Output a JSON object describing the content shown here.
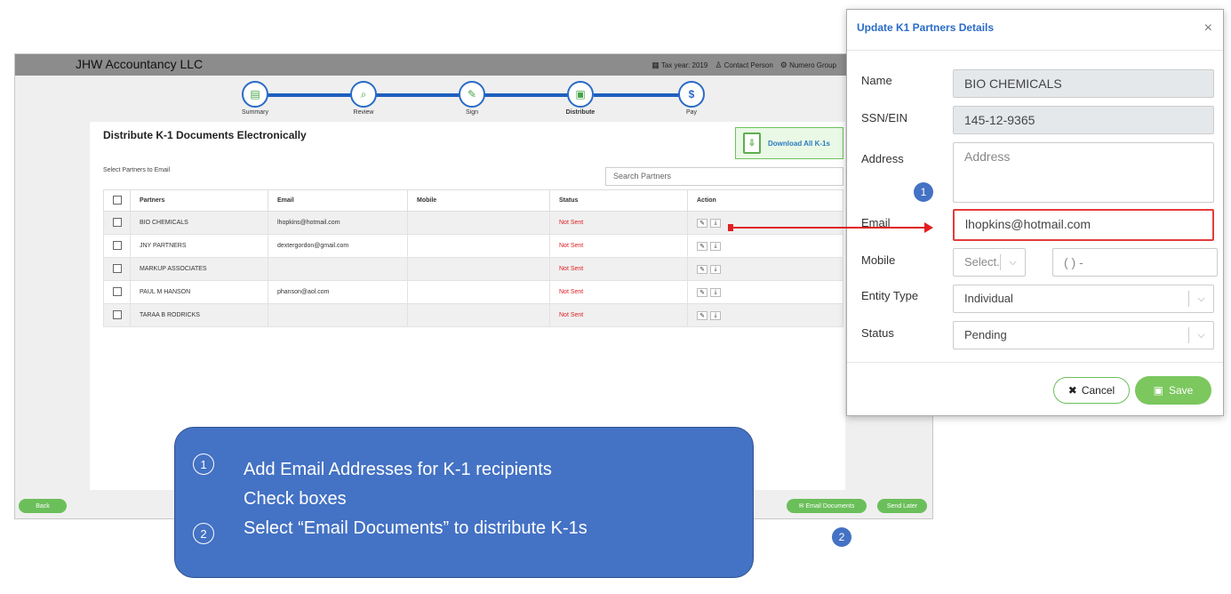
{
  "app": {
    "brand": "JHW Accountancy LLC",
    "tax_year": "Tax year: 2019",
    "contact_person": "Contact Person",
    "group": "Numero Group"
  },
  "steps": [
    {
      "label": "Summary",
      "icon": "document-icon"
    },
    {
      "label": "Review",
      "icon": "magnifier-document-icon"
    },
    {
      "label": "Sign",
      "icon": "pen-icon"
    },
    {
      "label": "Distribute",
      "icon": "share-document-icon"
    },
    {
      "label": "Pay",
      "icon": "dollar-icon"
    }
  ],
  "panel": {
    "title": "Distribute K-1 Documents Electronically",
    "download_all": "Download All K-1s",
    "select_label": "Select Partners to Email",
    "search_placeholder": "Search Partners"
  },
  "table": {
    "headers": [
      "Partners",
      "Email",
      "Mobile",
      "Status",
      "Action"
    ],
    "rows": [
      {
        "partner": "BIO CHEMICALS",
        "email": "lhopkins@hotmail.com",
        "mobile": "",
        "status": "Not Sent"
      },
      {
        "partner": "JNY PARTNERS",
        "email": "dextergordon@gmail.com",
        "mobile": "",
        "status": "Not Sent"
      },
      {
        "partner": "MARKUP ASSOCIATES",
        "email": "",
        "mobile": "",
        "status": "Not Sent"
      },
      {
        "partner": "PAUL M HANSON",
        "email": "phanson@aol.com",
        "mobile": "",
        "status": "Not Sent"
      },
      {
        "partner": "TARAA B RODRICKS",
        "email": "",
        "mobile": "",
        "status": "Not Sent"
      }
    ]
  },
  "footer": {
    "back": "Back",
    "email_documents": "Email Documents",
    "send_later": "Send Later"
  },
  "modal": {
    "title": "Update K1 Partners Details",
    "close": "×",
    "name_label": "Name",
    "name_value": "BIO CHEMICALS",
    "ssn_label": "SSN/EIN",
    "ssn_value": "145-12-9365",
    "address_label": "Address",
    "address_placeholder": "Address",
    "email_label": "Email",
    "email_value": "lhopkins@hotmail.com",
    "mobile_label": "Mobile",
    "mobile_select": "Select.",
    "mobile_placeholder": "( ) -",
    "entity_label": "Entity Type",
    "entity_value": "Individual",
    "status_label": "Status",
    "status_value": "Pending",
    "cancel": "Cancel",
    "save": "Save"
  },
  "callout": {
    "num1": "1",
    "line1": "Add Email Addresses for K-1 recipients",
    "line2": "Check boxes",
    "num2": "2",
    "line3": "Select “Email Documents” to distribute K-1s"
  },
  "badges": {
    "one": "1",
    "two": "2"
  },
  "colors": {
    "accent": "#4472c4",
    "green": "#6bbf5a",
    "red": "#e02020",
    "link_blue": "#2a6bc7"
  }
}
